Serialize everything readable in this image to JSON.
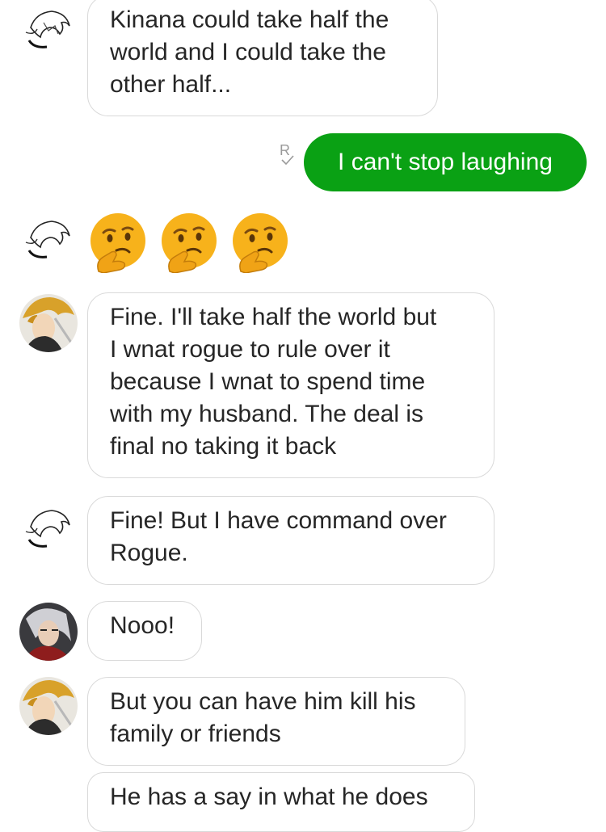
{
  "messages": [
    {
      "text": "Kinana could take half the\nworld and I could take the\nother half..."
    },
    {
      "text": "I can't stop laughing",
      "read_receipt": "R"
    },
    {
      "emoji": [
        "thinking-face",
        "thinking-face",
        "thinking-face"
      ]
    },
    {
      "text": "Fine. I'll take half the world but\nI wnat rogue to rule over it\nbecause I wnat to spend time\nwith my husband. The deal is\nfinal no taking it back"
    },
    {
      "text": "Fine! But I have command over\nRogue."
    },
    {
      "text": "Nooo!"
    },
    {
      "text": "But you can have him kill his\nfamily or friends"
    },
    {
      "text": "He has a say in what he does"
    }
  ],
  "colors": {
    "sent_bubble": "#0aa114",
    "received_border": "#d9d9d9",
    "read_receipt": "#9a9a9a"
  }
}
